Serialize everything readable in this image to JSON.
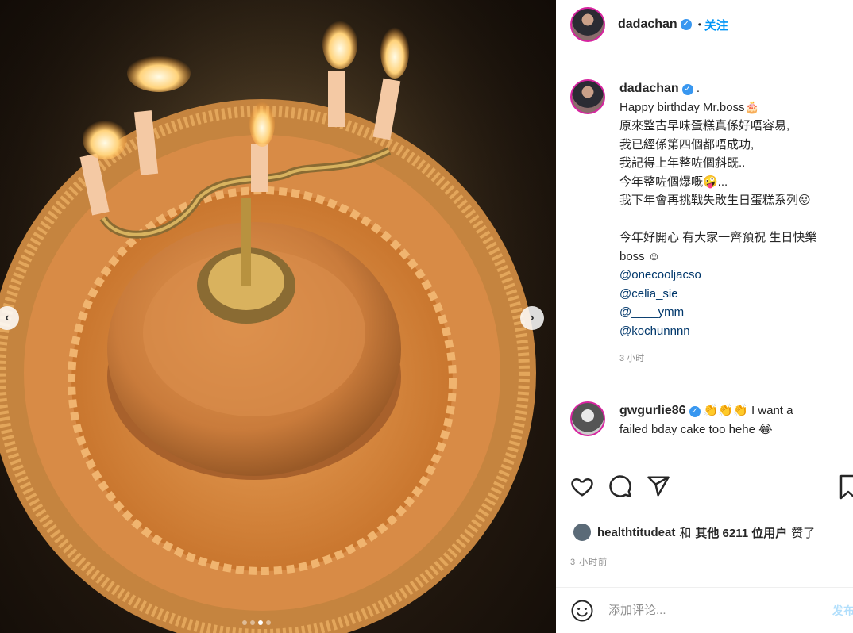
{
  "post": {
    "author": "dadachan",
    "follow_label": "关注",
    "dot_separator": "•",
    "caption_period": ".",
    "caption_lines": [
      "Happy birthday Mr.boss🎂",
      "原來整古早味蛋糕真係好唔容易,",
      "我已經係第四個都唔成功,",
      "我記得上年整咗個斜既..",
      "今年整咗個爆嘅🤪...",
      "我下年會再挑戰失敗生日蛋糕系列😝",
      "",
      "今年好開心 有大家一齊預祝 生日快樂",
      "boss ☺"
    ],
    "mentions": [
      "@onecooljacso",
      "@celia_sie",
      "@____ymm",
      "@kochunnnn"
    ],
    "caption_time": "3 小时"
  },
  "comment": {
    "user": "gwgurlie86",
    "text_line1": "👏👏👏 I want a",
    "text_line2": "failed bday cake too hehe 😂"
  },
  "likes": {
    "user": "healthtitudeat",
    "connector": "和",
    "others": "其他 6211 位用户",
    "suffix": "赞了"
  },
  "posted_time": "3 小时前",
  "comment_box": {
    "placeholder": "添加评论...",
    "post_label": "发布"
  },
  "carousel": {
    "prev": "‹",
    "next": "›",
    "dot_count": 4,
    "active_dot": 2
  },
  "icons": {
    "verified": "verified-badge",
    "like": "heart-icon",
    "comment": "comment-icon",
    "share": "share-icon",
    "save": "bookmark-icon",
    "emoji": "emoji-icon"
  },
  "colors": {
    "link_blue": "#0095f6",
    "mention_blue": "#00376b",
    "muted": "#8e8e8e"
  }
}
